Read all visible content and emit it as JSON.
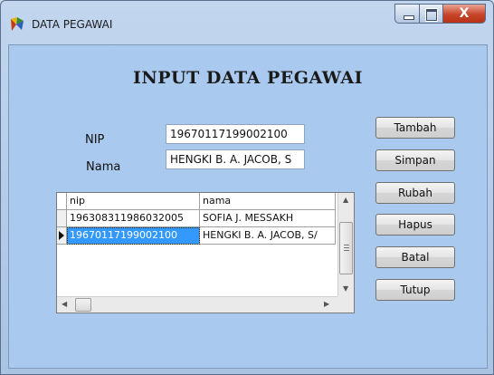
{
  "window": {
    "title": "DATA PEGAWAI",
    "icon": "app-icon",
    "accent_color": "#a9c9ee",
    "close_glyph": "X"
  },
  "form": {
    "heading": "INPUT DATA PEGAWAI",
    "nip_label": "NIP",
    "nama_label": "Nama",
    "nip_value": "19670117199002100",
    "nama_value": "HENGKI B. A. JACOB, S"
  },
  "buttons": {
    "tambah": "Tambah",
    "simpan": "Simpan",
    "rubah": "Rubah",
    "hapus": "Hapus",
    "batal": "Batal",
    "tutup": "Tutup"
  },
  "grid": {
    "columns": [
      "nip",
      "nama"
    ],
    "rows": [
      {
        "nip": "196308311986032005",
        "nama": "SOFIA J. MESSAKH"
      },
      {
        "nip": "19670117199002100",
        "nama": "HENGKI B. A. JACOB, S/",
        "selected": true
      }
    ]
  }
}
